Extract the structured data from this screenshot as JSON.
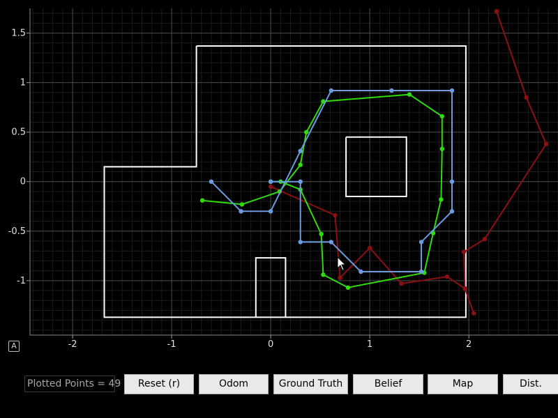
{
  "plot": {
    "background": "#000000",
    "minor_grid_color": "#1c1c1c",
    "major_grid_color": "#4a4a4a",
    "autoscale_label": "A"
  },
  "chart_data": {
    "type": "line",
    "title": "",
    "xlabel": "",
    "ylabel": "",
    "xlim": [
      -2.43,
      2.9
    ],
    "ylim": [
      -1.55,
      1.75
    ],
    "grid": true,
    "x_ticks": [
      -2,
      -1,
      0,
      1,
      2
    ],
    "x_tick_labels": [
      "-2",
      "-1",
      "0",
      "1",
      "2"
    ],
    "y_ticks": [
      1.5,
      1,
      0.5,
      0,
      -0.5,
      -1
    ],
    "y_tick_labels": [
      "1.5",
      "1",
      "0.5",
      "0",
      "-0.5",
      "-1"
    ],
    "map_walls": [
      [
        [
          -0.75,
          1.37
        ],
        [
          1.97,
          1.37
        ],
        [
          1.97,
          -1.37
        ],
        [
          -1.68,
          -1.37
        ],
        [
          -1.68,
          0.15
        ],
        [
          -0.75,
          0.15
        ],
        [
          -0.75,
          1.37
        ]
      ],
      [
        [
          0.76,
          0.45
        ],
        [
          1.37,
          0.45
        ],
        [
          1.37,
          -0.15
        ],
        [
          0.76,
          -0.15
        ],
        [
          0.76,
          0.45
        ]
      ],
      [
        [
          -0.15,
          -1.37
        ],
        [
          -0.15,
          -0.77
        ],
        [
          0.15,
          -0.77
        ],
        [
          0.15,
          -1.37
        ]
      ]
    ],
    "map_color": "#ffffff",
    "series": [
      {
        "color": "#8e0f12",
        "x": [
          0.0,
          0.65,
          0.7,
          1.0,
          1.32,
          1.78,
          1.96,
          2.05,
          1.96,
          1.95,
          2.16,
          2.78,
          2.58,
          2.28
        ],
        "y": [
          -0.05,
          -0.34,
          -0.97,
          -0.67,
          -1.03,
          -0.96,
          -1.08,
          -1.33,
          -1.08,
          -0.71,
          -0.58,
          0.38,
          0.85,
          1.72
        ]
      },
      {
        "color": "#2fdc0c",
        "x": [
          -0.69,
          -0.29,
          0.09,
          0.3,
          0.36,
          0.53,
          1.4,
          1.73,
          1.73,
          1.72,
          1.64,
          1.55,
          0.78,
          0.53,
          0.51,
          0.3,
          0.1,
          0.0
        ],
        "y": [
          -0.19,
          -0.23,
          -0.1,
          0.17,
          0.5,
          0.81,
          0.88,
          0.66,
          0.33,
          -0.18,
          -0.52,
          -0.92,
          -1.07,
          -0.94,
          -0.53,
          -0.08,
          0.0,
          0.0
        ]
      },
      {
        "color": "#6c9be0",
        "x": [
          -0.6,
          -0.3,
          0.0,
          0.3,
          0.61,
          1.22,
          1.83,
          1.83,
          1.83,
          1.52,
          1.52,
          0.91,
          0.61,
          0.3,
          0.3,
          0.0
        ],
        "y": [
          0.0,
          -0.3,
          -0.3,
          0.31,
          0.92,
          0.92,
          0.92,
          0.0,
          -0.3,
          -0.61,
          -0.91,
          -0.91,
          -0.61,
          -0.61,
          0.0,
          0.0
        ]
      }
    ]
  },
  "controls": {
    "plotted_points": "Plotted Points = 49",
    "reset": "Reset (r)",
    "odom": "Odom",
    "ground_truth": "Ground Truth",
    "belief": "Belief",
    "map": "Map",
    "dist": "Dist."
  }
}
